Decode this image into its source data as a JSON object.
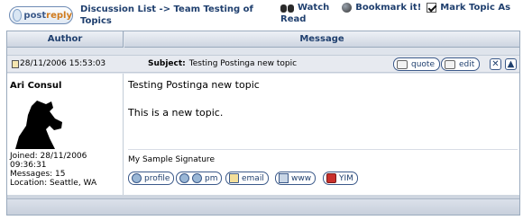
{
  "toolbar": {
    "post_reply_label_1": "post",
    "post_reply_label_2": "reply",
    "breadcrumb": "Discussion List -> Team Testing of Topics",
    "watch_label": "Watch",
    "bookmark_label": "Bookmark it!",
    "mark_read_label_1": "Mark Topic As",
    "mark_read_label_2": "Read"
  },
  "table": {
    "col_author": "Author",
    "col_message": "Message"
  },
  "post": {
    "date": "28/11/2006 15:53:03",
    "subject_label": "Subject:",
    "subject": "Testing Postinga new topic",
    "quote_label": "quote",
    "edit_label": "edit",
    "delete_glyph": "✕",
    "up_glyph": "▲",
    "author": "Ari Consul",
    "author_info": "Joined: 28/11/2006\n09:36:31\nMessages: 15\nLocation: Seattle, WA",
    "body_line1": "Testing Postinga  new topic",
    "body_line2": "This is a new topic.",
    "signature": "My Sample Signature",
    "actions": {
      "profile": "profile",
      "pm": "pm",
      "email": "email",
      "www": "www",
      "yim": "YIM"
    }
  },
  "colors": {
    "header_text": "#1f3f6e",
    "frame_border": "#9aaabd"
  },
  "icons": [
    "post-reply-icon",
    "binoculars-icon",
    "globe-icon",
    "checkbox-icon",
    "post-icon",
    "quote-icon",
    "edit-icon",
    "delete-icon",
    "top-icon",
    "avatar-dog"
  ]
}
